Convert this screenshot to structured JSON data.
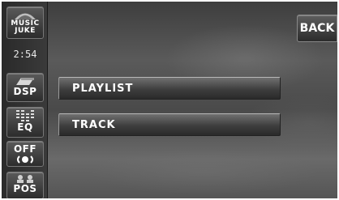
{
  "sidebar": {
    "logo": {
      "label_line1": "MUSIC",
      "label_line2": "JUKE",
      "icon": "music-juke-icon"
    },
    "clock": "2:54",
    "buttons": [
      {
        "id": "dsp",
        "label": "DSP",
        "icon": "dsp-icon"
      },
      {
        "id": "eq",
        "label": "EQ",
        "icon": "equalizer-icon"
      },
      {
        "id": "off",
        "label": "OFF",
        "icon": "surround-icon"
      },
      {
        "id": "pos",
        "label": "POS",
        "icon": "seat-position-icon"
      }
    ]
  },
  "header": {
    "back_label": "BACK"
  },
  "menu": {
    "items": [
      {
        "label": "PLAYLIST"
      },
      {
        "label": "TRACK"
      }
    ]
  },
  "colors": {
    "accent_text": "#ffffff",
    "button_face": "#3e3e3e",
    "background": "#4a4a4a"
  }
}
